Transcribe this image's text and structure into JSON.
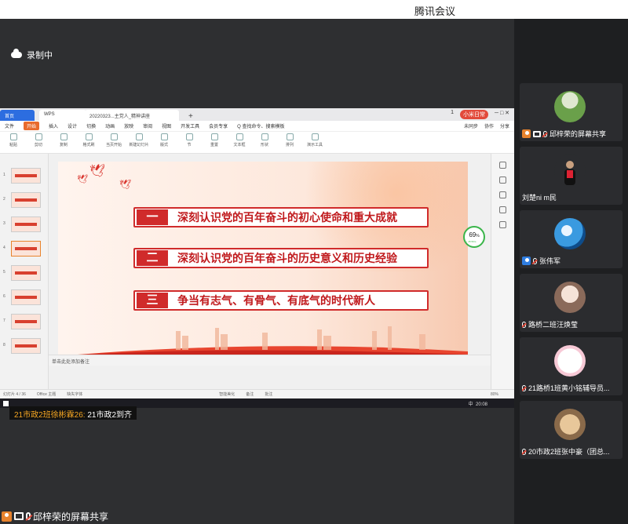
{
  "app": {
    "title": "腾讯会议"
  },
  "recording": {
    "label": "录制中"
  },
  "shared_screen": {
    "tabs": {
      "home": "首页",
      "ws": "WPS",
      "doc": "20220323...主党人_精神讲座",
      "plus": "+"
    },
    "tab_right": {
      "count": "1",
      "user": "小米日常"
    },
    "menu": [
      "文件",
      "开始",
      "插入",
      "设计",
      "切换",
      "动画",
      "放映",
      "审阅",
      "视图",
      "开发工具",
      "会员专享",
      "Q 查找命令、搜索模板"
    ],
    "menu_active_index": 1,
    "menu_right": [
      "未同步",
      "协作",
      "分享"
    ],
    "ribbon": [
      "粘贴",
      "剪切",
      "复制",
      "格式刷",
      "当页开始",
      "新建幻灯片",
      "版式",
      "节",
      "重置",
      "文本框",
      "形状",
      "排列",
      "演示工具"
    ],
    "slide": {
      "items": [
        {
          "num": "一",
          "text": "深刻认识党的百年奋斗的初心使命和重大成就"
        },
        {
          "num": "二",
          "text": "深刻认识党的百年奋斗的历史意义和历史经验"
        },
        {
          "num": "三",
          "text": "争当有志气、有骨气、有底气的时代新人"
        }
      ]
    },
    "gauge": {
      "value": "69",
      "unit": "%",
      "sub": "↑ 45.5K/s"
    },
    "notes_placeholder": "单击此处添加备注",
    "status": {
      "slide": "幻灯片 4 / 36",
      "theme": "Office 主题",
      "font": "缺失字体",
      "beautify": "智能美化",
      "comments": "备注",
      "annot": "批注",
      "zoom": "80%"
    },
    "thumbnail_numbers": [
      "1",
      "2",
      "3",
      "4",
      "5",
      "6",
      "7",
      "8"
    ],
    "taskbar": {
      "time": "20:08",
      "ime": "中"
    }
  },
  "caption": {
    "name": "21市政2班徐彬霖26:",
    "text": "21市政2到齐"
  },
  "footer": {
    "label": "邱梓荣的屏幕共享"
  },
  "participants": [
    {
      "name": "邱梓荣的屏幕共享",
      "avatar_icon": "landscape-avatar-icon",
      "screen": true
    },
    {
      "name": "刘楚ni m民",
      "avatar_icon": "person-video-icon",
      "screen": false
    },
    {
      "name": "张伟军",
      "avatar_icon": "ocean-avatar-icon",
      "screen": false
    },
    {
      "name": "路桥二班汪焕莹",
      "avatar_icon": "girl-avatar-icon",
      "screen": false
    },
    {
      "name": "21路桥1班黄小铭辅导员...",
      "avatar_icon": "cartoon-avatar-icon",
      "screen": false
    },
    {
      "name": "20市政2班张中豪（团总...",
      "avatar_icon": "cat-avatar-icon",
      "screen": false
    }
  ],
  "colors": {
    "accent": "#2f7de0",
    "slide_red": "#d02b2b",
    "brand_orange": "#e8832d"
  }
}
